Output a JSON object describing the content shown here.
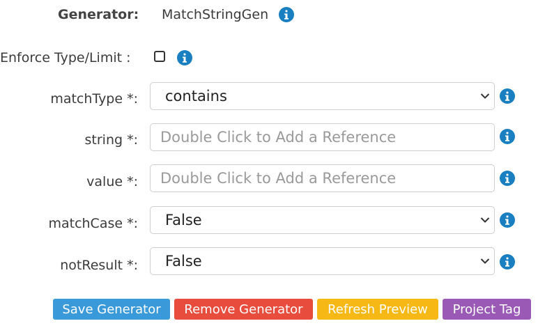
{
  "header": {
    "generator_label": "Generator:",
    "generator_value": "MatchStringGen"
  },
  "enforce": {
    "label": "Enforce Type/Limit :",
    "checked": false
  },
  "fields": {
    "match_type": {
      "label": "matchType *:",
      "value": "contains"
    },
    "string": {
      "label": "string *:",
      "placeholder": "Double Click to Add a Reference",
      "value": ""
    },
    "value": {
      "label": "value *:",
      "placeholder": "Double Click to Add a Reference",
      "value": ""
    },
    "match_case": {
      "label": "matchCase *:",
      "value": "False"
    },
    "not_result": {
      "label": "notResult *:",
      "value": "False"
    }
  },
  "buttons": {
    "save": {
      "label": "Save Generator",
      "color": "#3a9ad9"
    },
    "remove": {
      "label": "Remove Generator",
      "color": "#e84c3d"
    },
    "refresh": {
      "label": "Refresh Preview",
      "color": "#f5b814"
    },
    "tag": {
      "label": "Project Tag",
      "color": "#9b59b6"
    }
  },
  "icons": {
    "info": "info-icon",
    "dropdown": "chevron-down-icon",
    "info_color": "#1a7fc1"
  }
}
